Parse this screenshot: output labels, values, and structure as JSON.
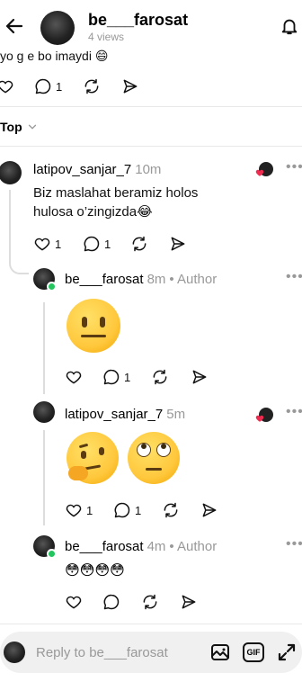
{
  "header": {
    "title": "be___farosat",
    "views": "4 views"
  },
  "prev_post": {
    "text_fragment": "yo g e bo imaydi 😄",
    "reply_count": "1"
  },
  "sort": {
    "label": "Top"
  },
  "comments": [
    {
      "username": "latipov_sanjar_7",
      "time": "10m",
      "text": "Biz maslahat beramiz holos hulosa o’zingizda😂",
      "likes": "1",
      "replies": "1"
    },
    {
      "username": "be___farosat",
      "time": "8m",
      "author_label": "• Author",
      "emoji": "😐",
      "replies": "1"
    },
    {
      "username": "latipov_sanjar_7",
      "time": "5m",
      "emoji": "🤔 🙄",
      "likes": "1",
      "replies": "1"
    },
    {
      "username": "be___farosat",
      "time": "4m",
      "author_label": "• Author",
      "text": "😳😳😳😳"
    }
  ],
  "reply_bar": {
    "placeholder": "Reply to be___farosat",
    "gif_label": "GIF"
  }
}
